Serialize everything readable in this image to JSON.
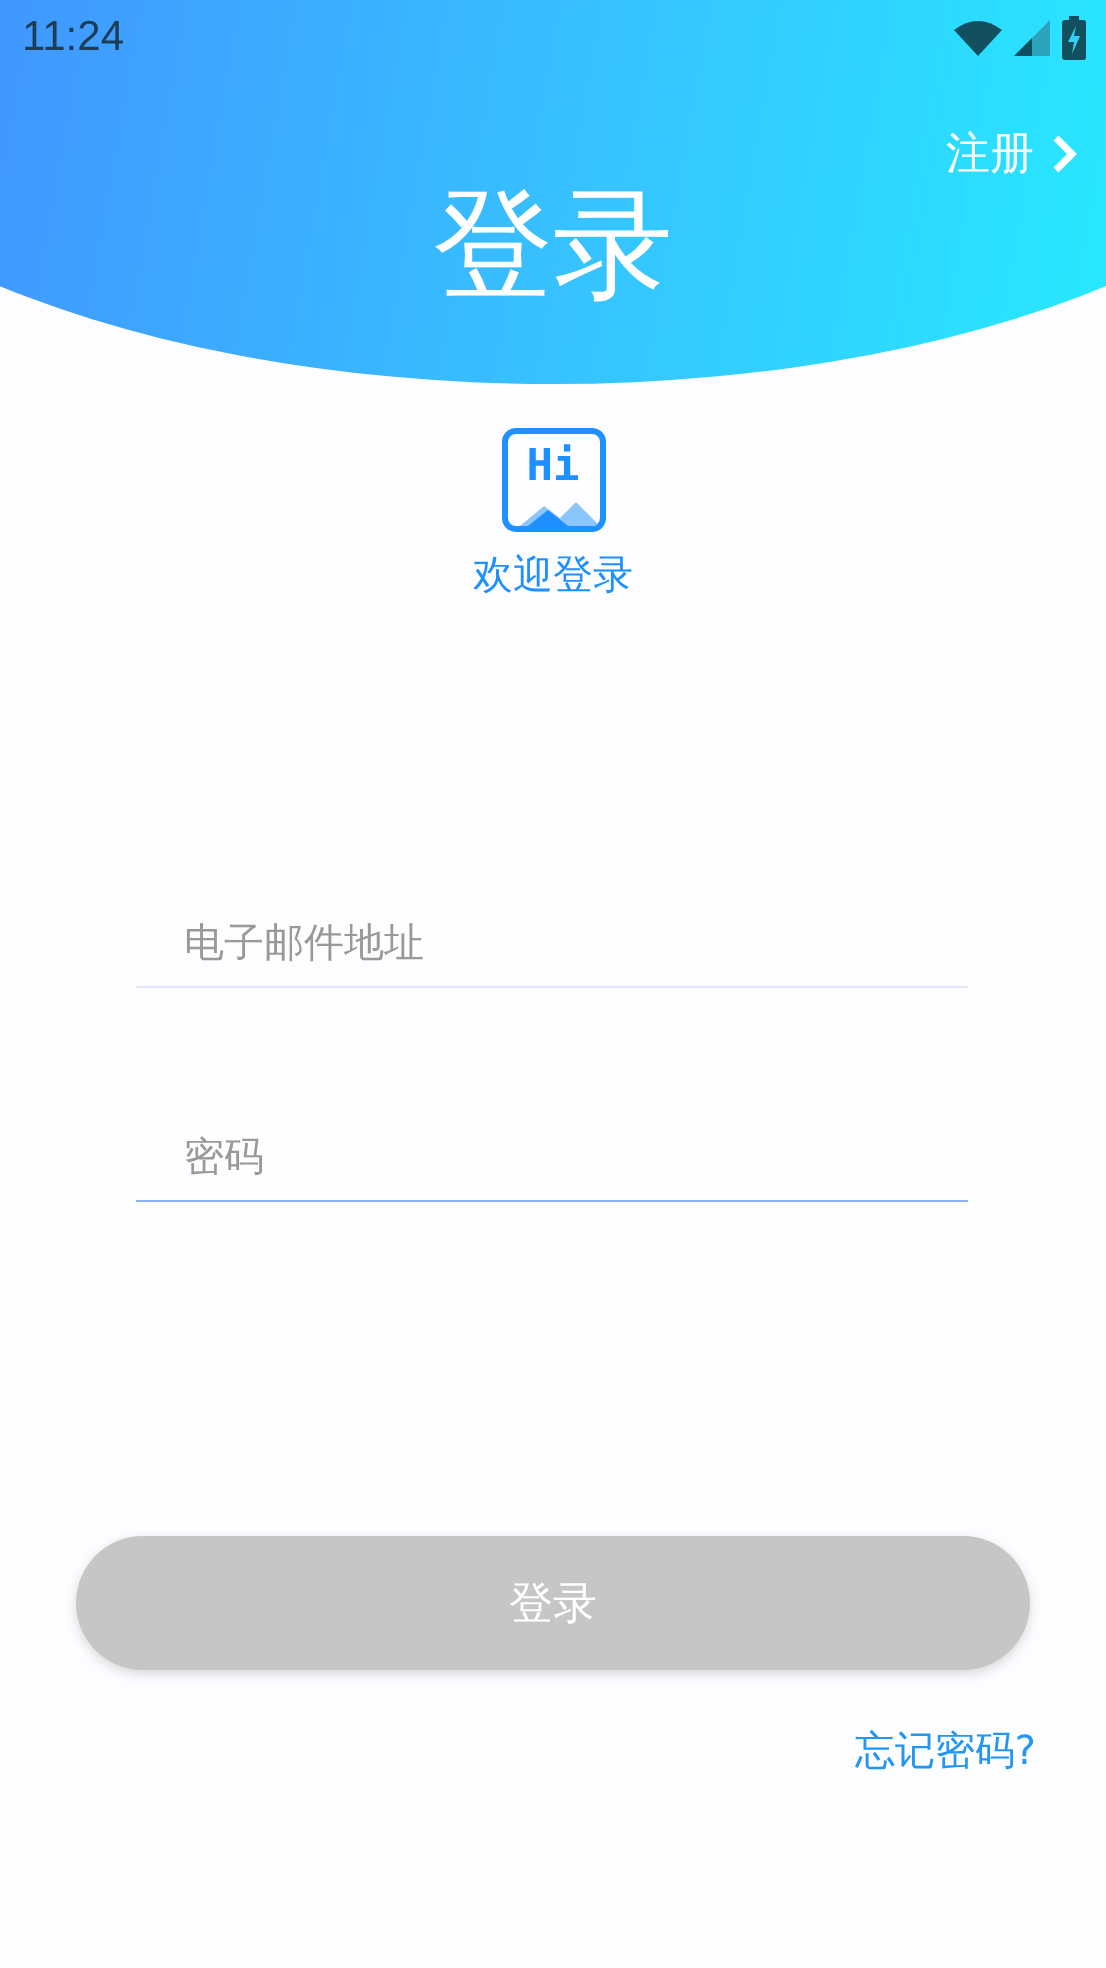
{
  "status_bar": {
    "time": "11:24"
  },
  "header": {
    "register_link": "注册",
    "title": "登录"
  },
  "logo": {
    "text": "Hi"
  },
  "welcome": "欢迎登录",
  "fields": [
    {
      "placeholder": "电子邮件地址",
      "focused": false
    },
    {
      "placeholder": "密码",
      "focused": true
    }
  ],
  "login_button": {
    "label": "登录",
    "disabled": true
  },
  "forgot_link": "忘记密码?"
}
